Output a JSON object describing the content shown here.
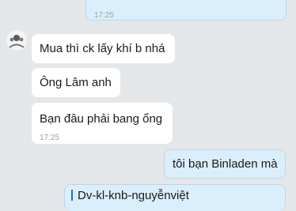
{
  "messages": [
    {
      "from": "me",
      "text": "",
      "time": "17:25"
    },
    {
      "from": "other",
      "text": "Mua thì ck lấy khí b nhá"
    },
    {
      "from": "other",
      "text": "Ông Lâm anh"
    },
    {
      "from": "other",
      "text": "Bạn đâu phải bang ổng",
      "time": "17:25"
    },
    {
      "from": "me",
      "text": "tôi bạn Binladen mà"
    },
    {
      "from": "me",
      "quote": "Dv-kl-knb-nguyễnviệt"
    }
  ]
}
